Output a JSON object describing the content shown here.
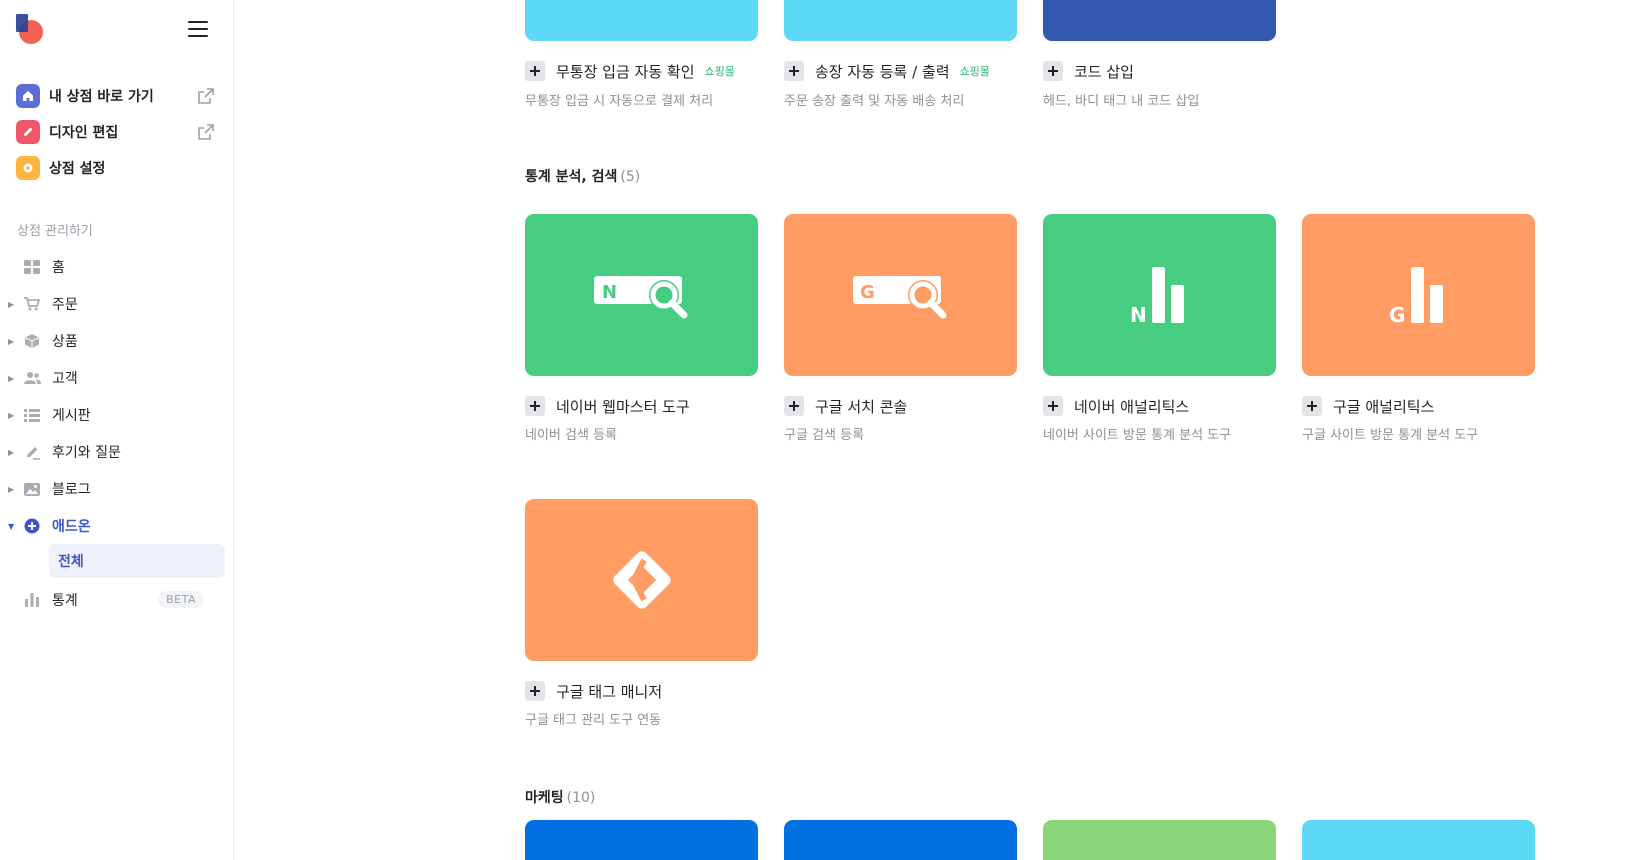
{
  "colors": {
    "accent": "#3d57c9",
    "green_tile": "#47cd82",
    "orange_tile": "#fe9c63",
    "cyan_tile": "#5ed8f7",
    "navy_tile": "#3259ad",
    "blue_tile": "#0270e0",
    "lightgreen_tile": "#89d379",
    "badge_green": "#2bb673"
  },
  "sidebar": {
    "quick_links": [
      {
        "label": "내 상점 바로 가기",
        "icon": "home-icon",
        "color": "#5b6fd6"
      },
      {
        "label": "디자인 편집",
        "icon": "pencil-icon",
        "color": "#f0566a"
      },
      {
        "label": "상점 설정",
        "icon": "gear-icon",
        "color": "#ffb340"
      }
    ],
    "section_label": "상점 관리하기",
    "nav": [
      {
        "label": "홈",
        "icon": "dashboard-icon"
      },
      {
        "label": "주문",
        "icon": "cart-icon"
      },
      {
        "label": "상품",
        "icon": "box-icon"
      },
      {
        "label": "고객",
        "icon": "users-icon"
      },
      {
        "label": "게시판",
        "icon": "list-icon"
      },
      {
        "label": "후기와 질문",
        "icon": "pen-icon"
      },
      {
        "label": "블로그",
        "icon": "image-icon"
      },
      {
        "label": "애드온",
        "icon": "plus-circle-icon"
      },
      {
        "label": "통계",
        "icon": "bar-chart-icon"
      }
    ],
    "sub_item": "전체",
    "beta_label": "BETA"
  },
  "top_cards": [
    {
      "title": "무통장 입금 자동 확인",
      "badge": "쇼핑몰",
      "desc": "무통장 입금 시 자동으로 결제 처리"
    },
    {
      "title": "송장 자동 등록 / 출력",
      "badge": "쇼핑몰",
      "desc": "주문 송장 출력 및 자동 배송 처리"
    },
    {
      "title": "코드 삽입",
      "badge": "",
      "desc": "헤드, 바디 태그 내 코드 삽입"
    }
  ],
  "analytics_section": {
    "title": "통계 분석, 검색",
    "count": "(5)",
    "cards": [
      {
        "title": "네이버 웹마스터 도구",
        "desc": "네이버 검색 등록",
        "icon": "naver-search-icon"
      },
      {
        "title": "구글 서치 콘솔",
        "desc": "구글 검색 등록",
        "icon": "google-search-icon"
      },
      {
        "title": "네이버 애널리틱스",
        "desc": "네이버 사이트 방문 통계 분석 도구",
        "icon": "naver-analytics-icon"
      },
      {
        "title": "구글 애널리틱스",
        "desc": "구글 사이트 방문 통계 분석 도구",
        "icon": "google-analytics-icon"
      },
      {
        "title": "구글 태그 매니저",
        "desc": "구글 태그 관리 도구 연동",
        "icon": "google-tag-manager-icon"
      }
    ]
  },
  "marketing_section": {
    "title": "마케팅",
    "count": "(10)"
  }
}
